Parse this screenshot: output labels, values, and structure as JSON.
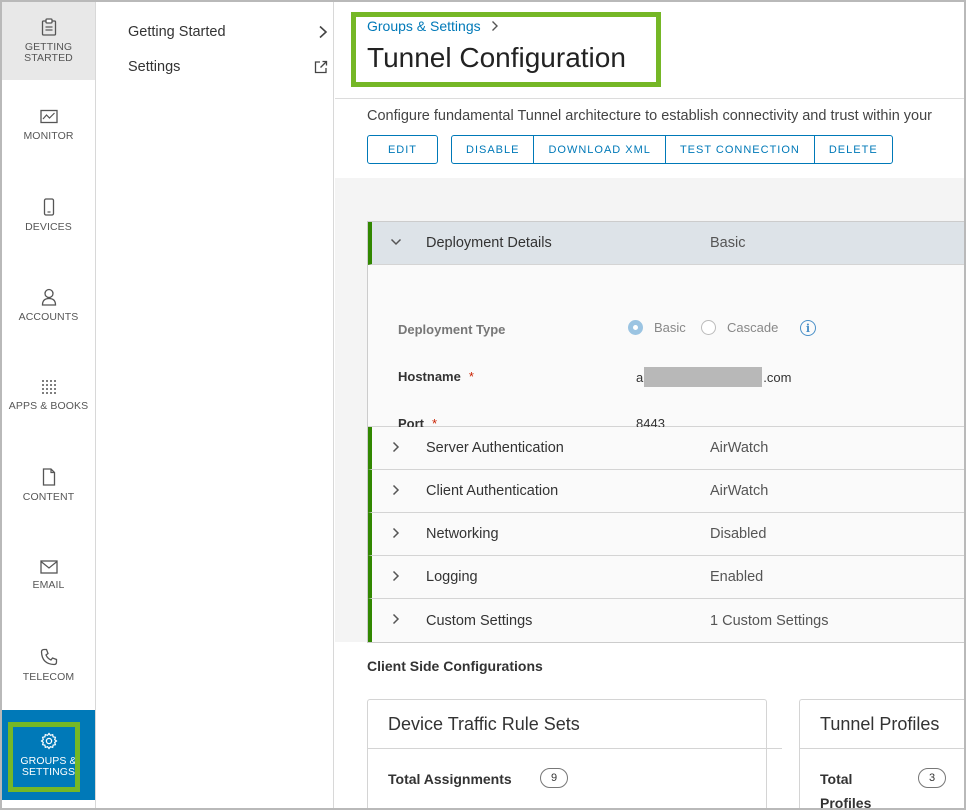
{
  "rail": {
    "items": [
      {
        "label": "GETTING STARTED",
        "icon": "clipboard-icon"
      },
      {
        "label": "MONITOR",
        "icon": "monitor-chart-icon"
      },
      {
        "label": "DEVICES",
        "icon": "phone-icon"
      },
      {
        "label": "ACCOUNTS",
        "icon": "user-icon"
      },
      {
        "label": "APPS & BOOKS",
        "icon": "apps-grid-icon"
      },
      {
        "label": "CONTENT",
        "icon": "document-icon"
      },
      {
        "label": "EMAIL",
        "icon": "envelope-icon"
      },
      {
        "label": "TELECOM",
        "icon": "telephone-icon"
      },
      {
        "label": "GROUPS & SETTINGS",
        "icon": "gear-icon"
      }
    ],
    "active_color": "#0079b8"
  },
  "subnav": {
    "items": [
      {
        "label": "Getting Started",
        "icon": "chevron-right-icon"
      },
      {
        "label": "Settings",
        "icon": "external-link-icon"
      }
    ]
  },
  "header": {
    "breadcrumb": "Groups & Settings",
    "title": "Tunnel Configuration",
    "description": "Configure fundamental Tunnel architecture to establish connectivity and trust within your"
  },
  "actions": {
    "edit": "EDIT",
    "disable": "DISABLE",
    "download_xml": "DOWNLOAD XML",
    "test_connection": "TEST CONNECTION",
    "delete": "DELETE"
  },
  "accordion": {
    "deployment": {
      "label": "Deployment Details",
      "value": "Basic",
      "deployment_type_label": "Deployment Type",
      "radio_basic": "Basic",
      "radio_cascade": "Cascade",
      "selected": "Basic",
      "hostname_label": "Hostname",
      "hostname_prefix": "a",
      "hostname_suffix": ".com",
      "port_label": "Port",
      "port_value": "8443",
      "required_mark": "*"
    },
    "rows": [
      {
        "label": "Server Authentication",
        "value": "AirWatch"
      },
      {
        "label": "Client Authentication",
        "value": "AirWatch"
      },
      {
        "label": "Networking",
        "value": "Disabled"
      },
      {
        "label": "Logging",
        "value": "Enabled"
      },
      {
        "label": "Custom Settings",
        "value": "1 Custom Settings"
      }
    ],
    "accent_color": "#318700"
  },
  "client_side": {
    "title": "Client Side Configurations",
    "cards": [
      {
        "title": "Device Traffic Rule Sets",
        "label": "Total Assignments",
        "count": "9"
      },
      {
        "title": "Tunnel Profiles",
        "label": "Total Profiles",
        "count": "3"
      }
    ]
  },
  "highlight_color": "#75b726"
}
